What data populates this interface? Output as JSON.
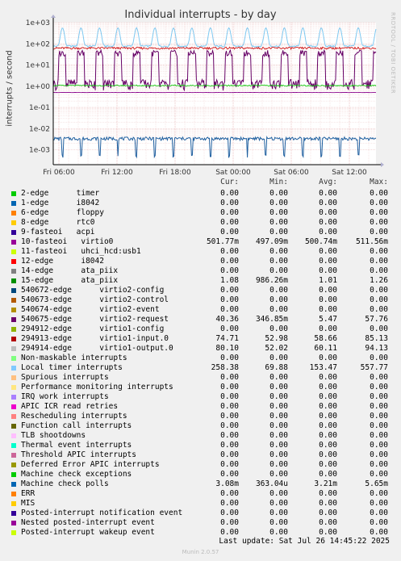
{
  "chart_data": {
    "type": "line",
    "title": "Individual interrupts - by day",
    "ylabel": "interrupts / second",
    "yscale": "log",
    "ylim": [
      0.0002,
      1000
    ],
    "y_ticks": [
      "1e+03",
      "1e+02",
      "1e+01",
      "1e+00",
      "1e-01",
      "1e-02",
      "1e-03"
    ],
    "x_ticks": [
      "Fri 06:00",
      "Fri 12:00",
      "Fri 18:00",
      "Sat 00:00",
      "Sat 06:00",
      "Sat 12:00"
    ],
    "series": [
      {
        "name": "Local timer interrupts",
        "color": "#7ec8f0",
        "min": 69.88,
        "max": 557.77
      },
      {
        "name": "294913-edge virtio1-input.0",
        "color": "#cc0000",
        "min": 52.98,
        "max": 85.13
      },
      {
        "name": "540675-edge virtio2-request",
        "color": "#660066",
        "min": 0.34685,
        "max": 57.76
      },
      {
        "name": "15-edge ata_piix",
        "color": "#00cc00",
        "min": 0.98626,
        "max": 1.26
      },
      {
        "name": "10-fasteoi virtio0",
        "color": "#880088",
        "min": 0.49709,
        "max": 0.51156
      },
      {
        "name": "Machine check polls",
        "color": "#1f5f9f",
        "min": 0.000363,
        "max": 0.00565
      }
    ]
  },
  "legend": {
    "headers": [
      "Cur:",
      "Min:",
      "Avg:",
      "Max:"
    ],
    "rows": [
      {
        "label": "2-edge      timer",
        "color": "#00cc00",
        "cur": "0.00",
        "min": "0.00",
        "avg": "0.00",
        "max": "0.00"
      },
      {
        "label": "1-edge      i8042",
        "color": "#0066b3",
        "cur": "0.00",
        "min": "0.00",
        "avg": "0.00",
        "max": "0.00"
      },
      {
        "label": "6-edge      floppy",
        "color": "#ff8000",
        "cur": "0.00",
        "min": "0.00",
        "avg": "0.00",
        "max": "0.00"
      },
      {
        "label": "8-edge      rtc0",
        "color": "#ffcc00",
        "cur": "0.00",
        "min": "0.00",
        "avg": "0.00",
        "max": "0.00"
      },
      {
        "label": "9-fasteoi   acpi",
        "color": "#330099",
        "cur": "0.00",
        "min": "0.00",
        "avg": "0.00",
        "max": "0.00"
      },
      {
        "label": "10-fasteoi   virtio0",
        "color": "#990099",
        "cur": "501.77m",
        "min": "497.09m",
        "avg": "500.74m",
        "max": "511.56m"
      },
      {
        "label": "11-fasteoi   uhci_hcd:usb1",
        "color": "#ccff00",
        "cur": "0.00",
        "min": "0.00",
        "avg": "0.00",
        "max": "0.00"
      },
      {
        "label": "12-edge      i8042",
        "color": "#ff0000",
        "cur": "0.00",
        "min": "0.00",
        "avg": "0.00",
        "max": "0.00"
      },
      {
        "label": "14-edge      ata_piix",
        "color": "#808080",
        "cur": "0.00",
        "min": "0.00",
        "avg": "0.00",
        "max": "0.00"
      },
      {
        "label": "15-edge      ata_piix",
        "color": "#008f00",
        "cur": "1.08",
        "min": "986.26m",
        "avg": "1.01",
        "max": "1.26"
      },
      {
        "label": "540672-edge      virtio2-config",
        "color": "#00487d",
        "cur": "0.00",
        "min": "0.00",
        "avg": "0.00",
        "max": "0.00"
      },
      {
        "label": "540673-edge      virtio2-control",
        "color": "#b35a00",
        "cur": "0.00",
        "min": "0.00",
        "avg": "0.00",
        "max": "0.00"
      },
      {
        "label": "540674-edge      virtio2-event",
        "color": "#b38f00",
        "cur": "0.00",
        "min": "0.00",
        "avg": "0.00",
        "max": "0.00"
      },
      {
        "label": "540675-edge      virtio2-request",
        "color": "#6b006b",
        "cur": "40.36",
        "min": "346.85m",
        "avg": "5.47",
        "max": "57.76"
      },
      {
        "label": "294912-edge      virtio1-config",
        "color": "#8fb300",
        "cur": "0.00",
        "min": "0.00",
        "avg": "0.00",
        "max": "0.00"
      },
      {
        "label": "294913-edge      virtio1-input.0",
        "color": "#b30000",
        "cur": "74.71",
        "min": "52.98",
        "avg": "58.66",
        "max": "85.13"
      },
      {
        "label": "294914-edge      virtio1-output.0",
        "color": "#bebebe",
        "cur": "80.10",
        "min": "52.02",
        "avg": "60.11",
        "max": "94.13"
      },
      {
        "label": "Non-maskable interrupts",
        "color": "#80ff80",
        "cur": "0.00",
        "min": "0.00",
        "avg": "0.00",
        "max": "0.00"
      },
      {
        "label": "Local timer interrupts",
        "color": "#80c9ff",
        "cur": "258.38",
        "min": "69.88",
        "avg": "153.47",
        "max": "557.77"
      },
      {
        "label": "Spurious interrupts",
        "color": "#ffc080",
        "cur": "0.00",
        "min": "0.00",
        "avg": "0.00",
        "max": "0.00"
      },
      {
        "label": "Performance monitoring interrupts",
        "color": "#ffe680",
        "cur": "0.00",
        "min": "0.00",
        "avg": "0.00",
        "max": "0.00"
      },
      {
        "label": "IRQ work interrupts",
        "color": "#aa80ff",
        "cur": "0.00",
        "min": "0.00",
        "avg": "0.00",
        "max": "0.00"
      },
      {
        "label": "APIC ICR read retries",
        "color": "#ee00cc",
        "cur": "0.00",
        "min": "0.00",
        "avg": "0.00",
        "max": "0.00"
      },
      {
        "label": "Rescheduling interrupts",
        "color": "#ff8080",
        "cur": "0.00",
        "min": "0.00",
        "avg": "0.00",
        "max": "0.00"
      },
      {
        "label": "Function call interrupts",
        "color": "#666600",
        "cur": "0.00",
        "min": "0.00",
        "avg": "0.00",
        "max": "0.00"
      },
      {
        "label": "TLB shootdowns",
        "color": "#ffbfff",
        "cur": "0.00",
        "min": "0.00",
        "avg": "0.00",
        "max": "0.00"
      },
      {
        "label": "Thermal event interrupts",
        "color": "#00ffcc",
        "cur": "0.00",
        "min": "0.00",
        "avg": "0.00",
        "max": "0.00"
      },
      {
        "label": "Threshold APIC interrupts",
        "color": "#cc6699",
        "cur": "0.00",
        "min": "0.00",
        "avg": "0.00",
        "max": "0.00"
      },
      {
        "label": "Deferred Error APIC interrupts",
        "color": "#999900",
        "cur": "0.00",
        "min": "0.00",
        "avg": "0.00",
        "max": "0.00"
      },
      {
        "label": "Machine check exceptions",
        "color": "#00cc00",
        "cur": "0.00",
        "min": "0.00",
        "avg": "0.00",
        "max": "0.00"
      },
      {
        "label": "Machine check polls",
        "color": "#0066b3",
        "cur": "3.08m",
        "min": "363.04u",
        "avg": "3.21m",
        "max": "5.65m"
      },
      {
        "label": "ERR",
        "color": "#ff8000",
        "cur": "0.00",
        "min": "0.00",
        "avg": "0.00",
        "max": "0.00"
      },
      {
        "label": "MIS",
        "color": "#ffcc00",
        "cur": "0.00",
        "min": "0.00",
        "avg": "0.00",
        "max": "0.00"
      },
      {
        "label": "Posted-interrupt notification event",
        "color": "#330099",
        "cur": "0.00",
        "min": "0.00",
        "avg": "0.00",
        "max": "0.00"
      },
      {
        "label": "Nested posted-interrupt event",
        "color": "#990099",
        "cur": "0.00",
        "min": "0.00",
        "avg": "0.00",
        "max": "0.00"
      },
      {
        "label": "Posted-interrupt wakeup event",
        "color": "#ccff00",
        "cur": "0.00",
        "min": "0.00",
        "avg": "0.00",
        "max": "0.00"
      }
    ]
  },
  "footer": {
    "last_update": "Last update: Sat Jul 26 14:45:22 2025",
    "munin": "Munin 2.0.57",
    "side": "RRDTOOL / TOBI OETIKER"
  }
}
